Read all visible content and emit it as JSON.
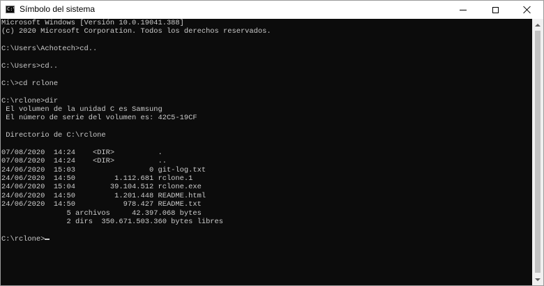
{
  "window": {
    "title": "Símbolo del sistema",
    "icon": "cmd-icon",
    "icon_text": "C:\\"
  },
  "controls": {
    "minimize": "minimize-icon",
    "maximize": "maximize-icon",
    "close": "close-icon"
  },
  "console": {
    "lines": [
      "Microsoft Windows [Versión 10.0.19041.388]",
      "(c) 2020 Microsoft Corporation. Todos los derechos reservados.",
      "",
      "C:\\Users\\Achotech>cd..",
      "",
      "C:\\Users>cd..",
      "",
      "C:\\>cd rclone",
      "",
      "C:\\rclone>dir",
      " El volumen de la unidad C es Samsung",
      " El número de serie del volumen es: 42C5-19CF",
      "",
      " Directorio de C:\\rclone",
      "",
      "07/08/2020  14:24    <DIR>          .",
      "07/08/2020  14:24    <DIR>          ..",
      "24/06/2020  15:03                 0 git-log.txt",
      "24/06/2020  14:50         1.112.681 rclone.1",
      "24/06/2020  15:04        39.104.512 rclone.exe",
      "24/06/2020  14:50         1.201.448 README.html",
      "24/06/2020  14:50           978.427 README.txt",
      "               5 archivos     42.397.068 bytes",
      "               2 dirs  350.671.503.360 bytes libres",
      ""
    ],
    "prompt": "C:\\rclone>"
  },
  "colors": {
    "console_bg": "#0c0c0c",
    "console_fg": "#cccccc"
  }
}
